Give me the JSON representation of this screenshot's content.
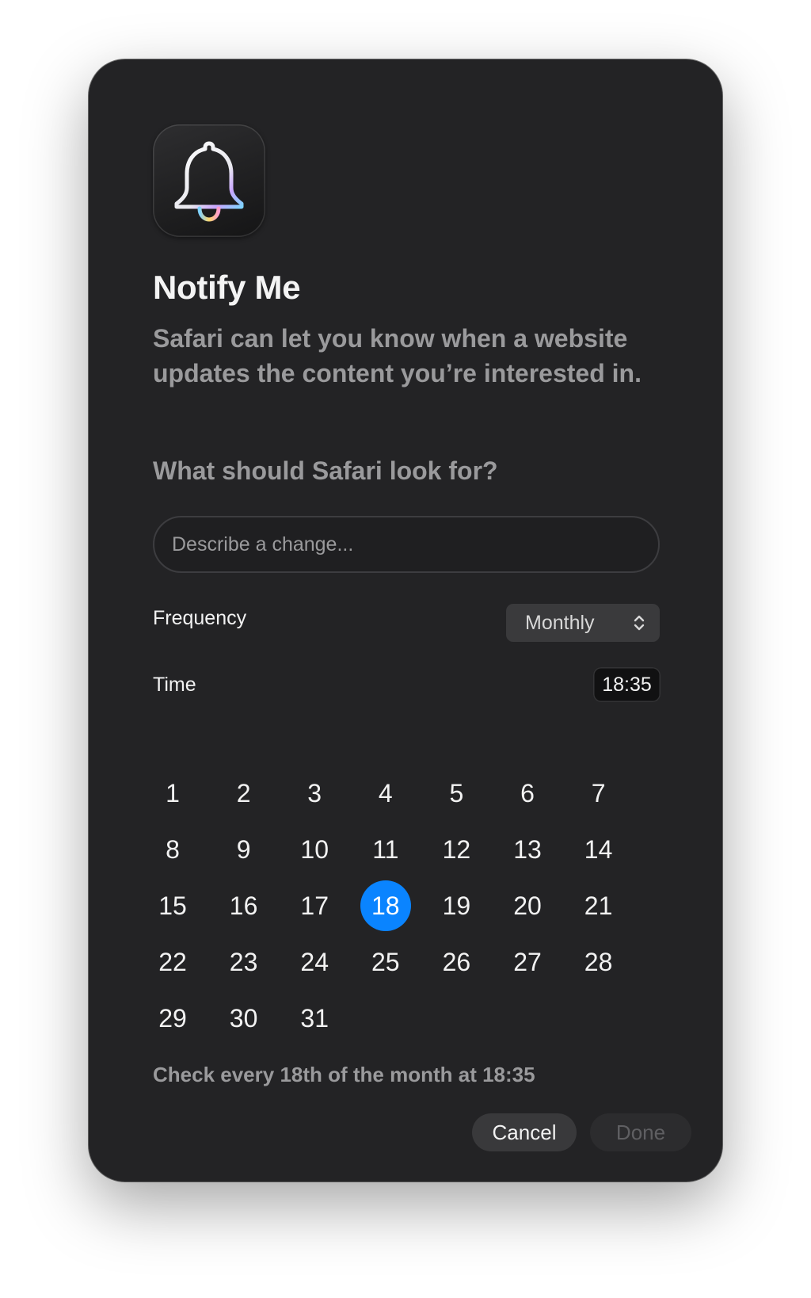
{
  "dialog": {
    "title": "Notify Me",
    "subtitle": "Safari can let you know when a website updates the content you’re interested in.",
    "question": "What should Safari look for?",
    "app_icon": "bell-icon"
  },
  "search": {
    "placeholder": "Describe a change..."
  },
  "frequency": {
    "label": "Frequency",
    "value": "Monthly"
  },
  "time": {
    "label": "Time",
    "value": "18:35"
  },
  "calendar": {
    "selected_day": "18",
    "days": [
      "1",
      "2",
      "3",
      "4",
      "5",
      "6",
      "7",
      "8",
      "9",
      "10",
      "11",
      "12",
      "13",
      "14",
      "15",
      "16",
      "17",
      "18",
      "19",
      "20",
      "21",
      "22",
      "23",
      "24",
      "25",
      "26",
      "27",
      "28",
      "29",
      "30",
      "31"
    ]
  },
  "summary": "Check every 18th of the month at 18:35",
  "buttons": {
    "cancel": "Cancel",
    "done": "Done"
  },
  "colors": {
    "background": "#232325",
    "accent": "#0a84ff",
    "secondary_text": "#9a9a9c"
  }
}
